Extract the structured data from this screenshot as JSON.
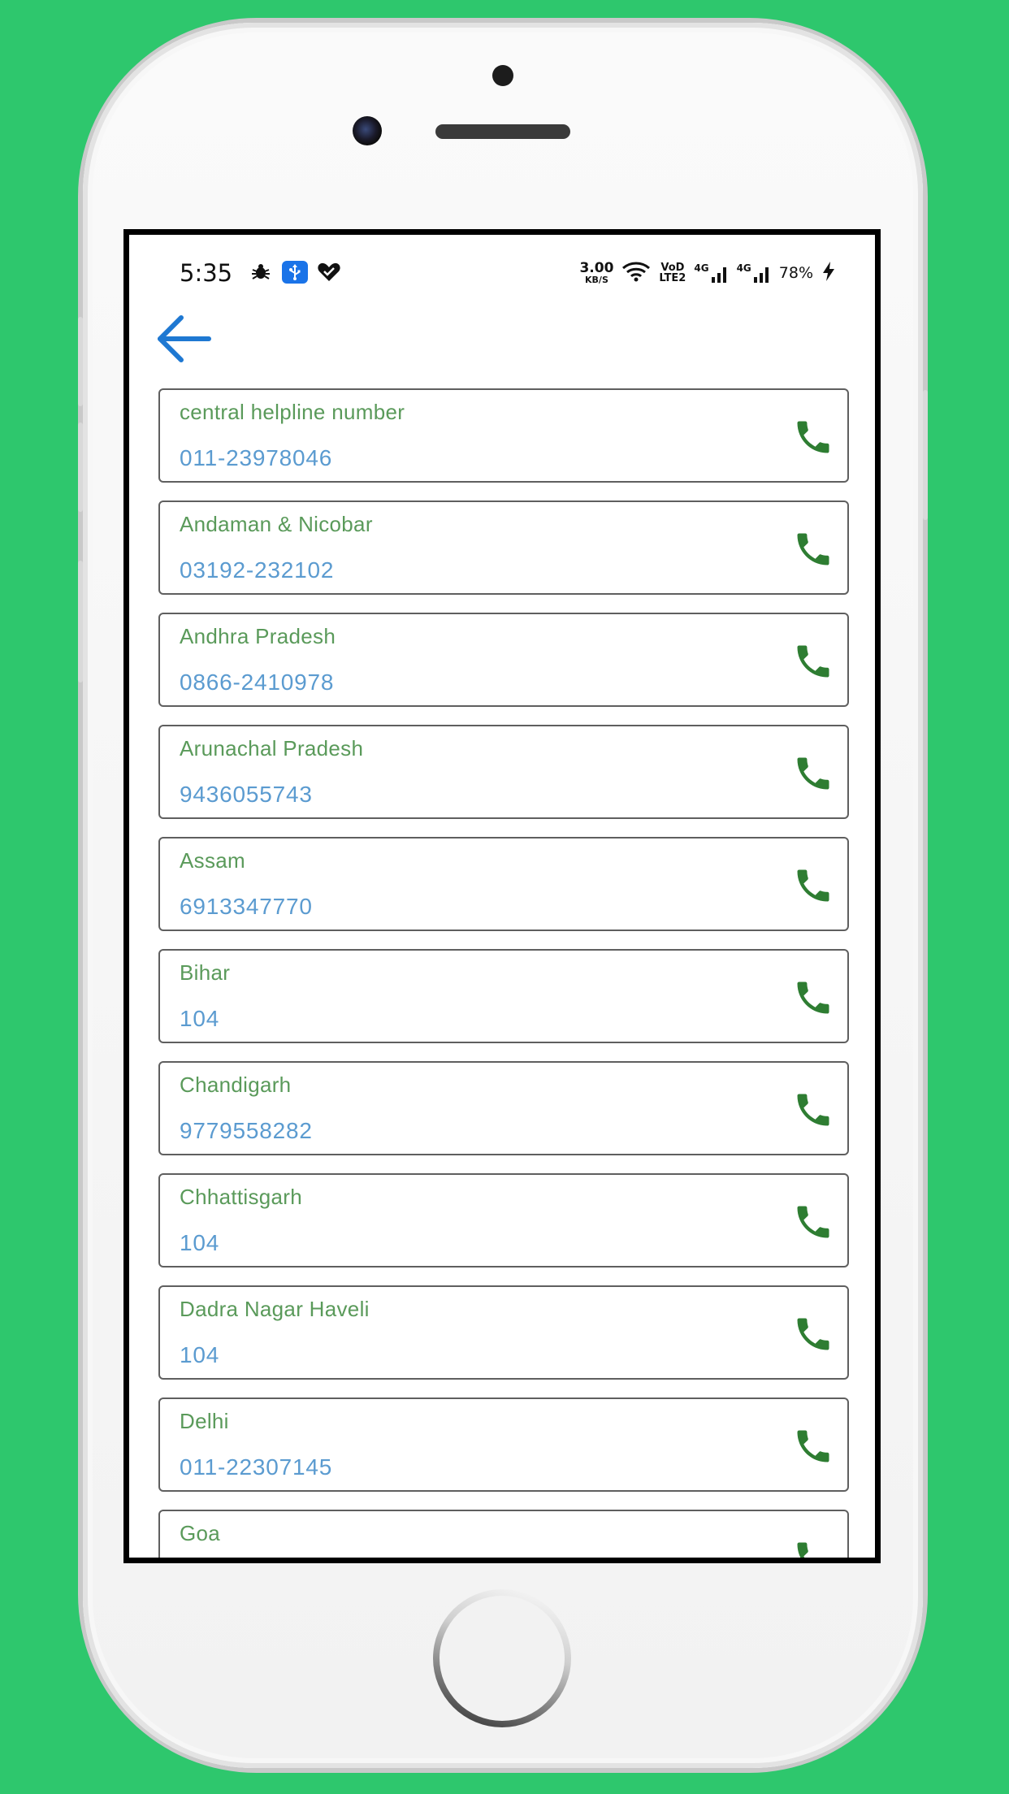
{
  "colors": {
    "background": "#2ec76d",
    "accent_blue": "#1e78d2",
    "name_text": "#5a9a5a",
    "number_text": "#5b9bd0",
    "call_icon": "#2e7d32",
    "card_border": "#5f5f5f"
  },
  "status_bar": {
    "time": "5:35",
    "left_icons": [
      "bug-icon",
      "usb-icon",
      "heart-check-icon"
    ],
    "speed_value": "3.00",
    "speed_unit": "KB/S",
    "volte_top": "VoD",
    "volte_bottom": "LTE2",
    "network1": "4G",
    "network2": "4G",
    "battery": "78%",
    "right_icons": [
      "wifi-icon",
      "signal-icon",
      "signal-icon",
      "charging-icon"
    ]
  },
  "header": {
    "back_icon": "arrow-left-icon"
  },
  "contacts": [
    {
      "name": "central helpline number",
      "number": "011-23978046"
    },
    {
      "name": "Andaman & Nicobar",
      "number": "03192-232102"
    },
    {
      "name": "Andhra Pradesh",
      "number": "0866-2410978"
    },
    {
      "name": "Arunachal Pradesh",
      "number": "9436055743"
    },
    {
      "name": "Assam",
      "number": "6913347770"
    },
    {
      "name": "Bihar",
      "number": "104"
    },
    {
      "name": "Chandigarh",
      "number": "9779558282"
    },
    {
      "name": "Chhattisgarh",
      "number": "104"
    },
    {
      "name": "Dadra Nagar Haveli",
      "number": "104"
    },
    {
      "name": "Delhi",
      "number": "011-22307145"
    },
    {
      "name": "Goa",
      "number": ""
    }
  ]
}
